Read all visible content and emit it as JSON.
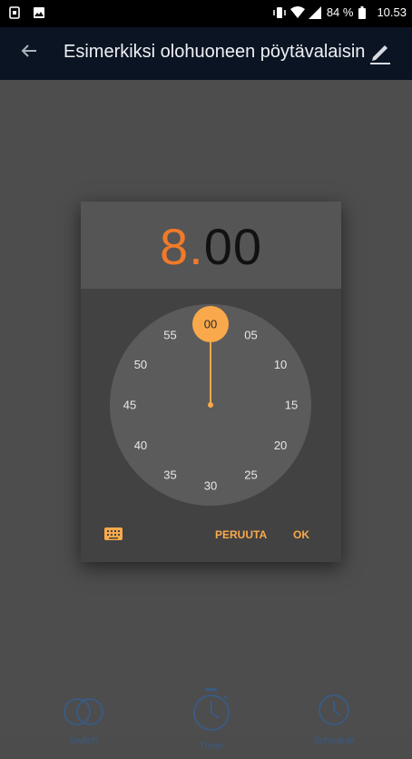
{
  "status_bar": {
    "battery": "84 %",
    "time": "10.53",
    "icons": [
      "sim-card-icon",
      "image-icon",
      "vibrate-icon",
      "wifi-icon",
      "signal-icon",
      "battery-icon"
    ]
  },
  "app_bar": {
    "title": "Esimerkiksi olohuoneen pöytävalaisin",
    "back_icon": "arrow-back-icon",
    "edit_icon": "pencil-icon"
  },
  "time_picker": {
    "hour": "8",
    "separator": ".",
    "minute": "00",
    "mode": "minutes",
    "selected_value": "00",
    "dial_labels": [
      "00",
      "05",
      "10",
      "15",
      "20",
      "25",
      "30",
      "35",
      "40",
      "45",
      "50",
      "55"
    ],
    "cancel_label": "PERUUTA",
    "ok_label": "OK",
    "keyboard_icon": "keyboard-icon"
  },
  "bottom_actions": [
    {
      "label": "Switch",
      "icon": "toggle-circles-icon"
    },
    {
      "label": "Timer",
      "icon": "stopwatch-icon"
    },
    {
      "label": "Schedule",
      "icon": "clock-icon"
    }
  ],
  "colors": {
    "accent": "#f9a94b",
    "hour_accent": "#f07a2a",
    "app_bar": "#0b1422",
    "dialog": "#424242",
    "dim_background": "#4d4d4d"
  }
}
